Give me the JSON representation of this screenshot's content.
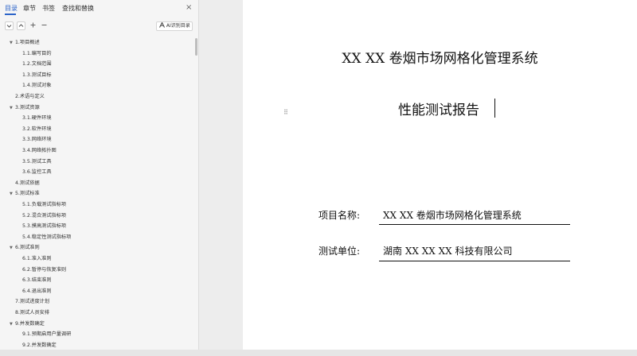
{
  "sidebar": {
    "tabs": [
      {
        "label": "目录"
      },
      {
        "label": "章节"
      },
      {
        "label": "书签"
      },
      {
        "label": "查找和替换"
      }
    ],
    "close": "×",
    "ai_button": "AI识别目录",
    "toc": [
      {
        "text": "1.项目概述",
        "level": 1,
        "expanded": true
      },
      {
        "text": "1.1.编写目的",
        "level": 2
      },
      {
        "text": "1.2.文档范围",
        "level": 2
      },
      {
        "text": "1.3.测试目标",
        "level": 2
      },
      {
        "text": "1.4.测试对象",
        "level": 2
      },
      {
        "text": "2.术语与定义",
        "level": 1
      },
      {
        "text": "3.测试资源",
        "level": 1,
        "expanded": true
      },
      {
        "text": "3.1.硬件环境",
        "level": 2
      },
      {
        "text": "3.2.软件环境",
        "level": 2
      },
      {
        "text": "3.3.网络环境",
        "level": 2
      },
      {
        "text": "3.4.网络拓扑图",
        "level": 2
      },
      {
        "text": "3.5.测试工具",
        "level": 2
      },
      {
        "text": "3.6.监控工具",
        "level": 2
      },
      {
        "text": "4.测试依据",
        "level": 1
      },
      {
        "text": "5.测试标准",
        "level": 1,
        "expanded": true
      },
      {
        "text": "5.1.负载测试指标项",
        "level": 2
      },
      {
        "text": "5.2.混合测试指标项",
        "level": 2
      },
      {
        "text": "5.3.摸高测试指标项",
        "level": 2
      },
      {
        "text": "5.4.稳定性测试指标项",
        "level": 2
      },
      {
        "text": "6.测试准则",
        "level": 1,
        "expanded": true
      },
      {
        "text": "6.1.准入准则",
        "level": 2
      },
      {
        "text": "6.2.暂停与恢复准则",
        "level": 2
      },
      {
        "text": "6.3.结束准则",
        "level": 2
      },
      {
        "text": "6.4.退出准则",
        "level": 2
      },
      {
        "text": "7.测试进度计划",
        "level": 1
      },
      {
        "text": "8.测试人员安排",
        "level": 1
      },
      {
        "text": "9.并发数确定",
        "level": 1,
        "expanded": true
      },
      {
        "text": "9.1.预期启用户量调研",
        "level": 2
      },
      {
        "text": "9.2.并发数确定",
        "level": 2
      }
    ]
  },
  "document": {
    "title": "XX XX 卷烟市场网格化管理系统",
    "subtitle": "性能测试报告",
    "fields": [
      {
        "label": "项目名称:",
        "value": "XX XX 卷烟市场网格化管理系统"
      },
      {
        "label": "测试单位:",
        "value": "湖南 XX XX XX 科技有限公司"
      }
    ]
  },
  "icons": {
    "collapse": "chevron-down-icon",
    "expand": "chevron-up-icon",
    "add": "plus-icon",
    "remove": "minus-icon",
    "ai": "ai-icon",
    "drag": "drag-handle-icon"
  },
  "colors": {
    "accent": "#2b63c9"
  }
}
